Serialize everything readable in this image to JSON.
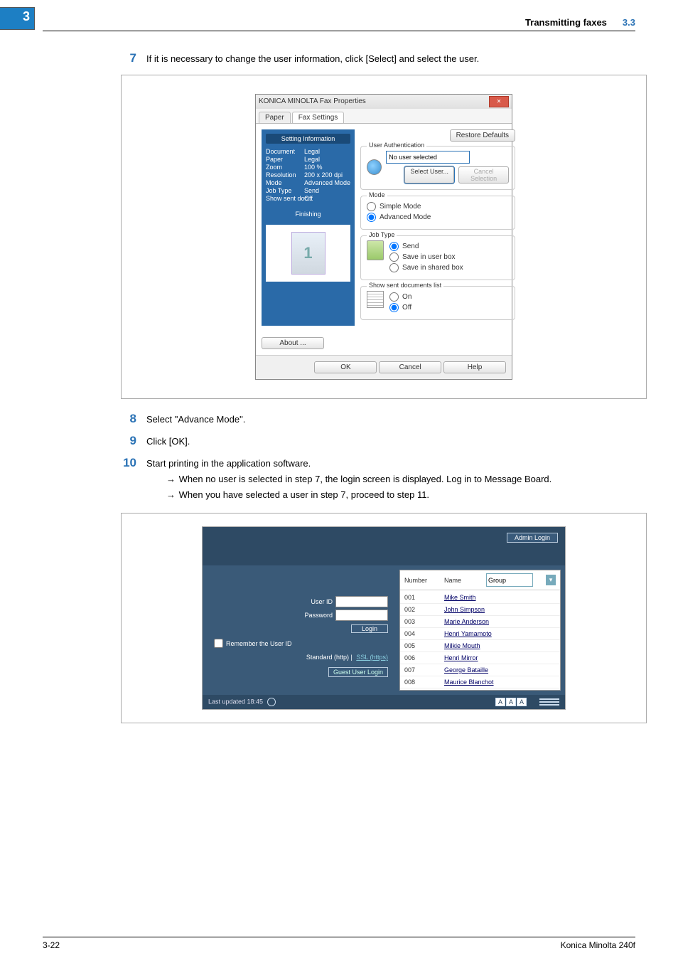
{
  "chapter_num": "3",
  "header": {
    "title": "Transmitting faxes",
    "section": "3.3"
  },
  "steps": {
    "7": {
      "num": "7",
      "text": "If it is necessary to change the user information, click [Select] and select the user."
    },
    "8": {
      "num": "8",
      "text": "Select \"Advance Mode\"."
    },
    "9": {
      "num": "9",
      "text": "Click [OK]."
    },
    "10": {
      "num": "10",
      "text": "Start printing in the application software.",
      "subs": {
        "a": "When no user is selected in step 7, the login screen is displayed. Log in to Message Board.",
        "b": "When you have selected a user in step 7, proceed to step 11."
      }
    }
  },
  "fax_dialog": {
    "title": "KONICA MINOLTA Fax Properties",
    "tabs": {
      "paper": "Paper",
      "fax": "Fax Settings"
    },
    "info": {
      "heading": "Setting Information",
      "rows": {
        "doc_k": "Document",
        "doc_v": "Legal",
        "paper_k": "Paper",
        "paper_v": "Legal",
        "zoom_k": "Zoom",
        "zoom_v": "100 %",
        "res_k": "Resolution",
        "res_v": "200 x 200 dpi",
        "mode_k": "Mode",
        "mode_v": "Advanced Mode",
        "job_k": "Job Type",
        "job_v": "Send",
        "show_k": "Show sent doc...",
        "show_v": "Off"
      },
      "finishing": "Finishing",
      "doc_num": "1"
    },
    "restore": "Restore Defaults",
    "auth": {
      "legend": "User Authentication",
      "no_user": "No user selected",
      "select": "Select User...",
      "cancel": "Cancel Selection"
    },
    "mode": {
      "legend": "Mode",
      "simple": "Simple Mode",
      "advanced": "Advanced Mode"
    },
    "job": {
      "legend": "Job Type",
      "send": "Send",
      "userbox": "Save in user box",
      "shared": "Save in shared box"
    },
    "showlist": {
      "legend": "Show sent documents list",
      "on": "On",
      "off": "Off"
    },
    "about": "About ...",
    "footer": {
      "ok": "OK",
      "cancel": "Cancel",
      "help": "Help"
    }
  },
  "login": {
    "admin": "Admin Login",
    "user_id": "User ID",
    "password": "Password",
    "login": "Login",
    "remember": "Remember the User ID",
    "std": "Standard (http)",
    "ssl": "SSL (https)",
    "guest": "Guest User Login",
    "cols": {
      "number": "Number",
      "name": "Name",
      "group": "Group"
    },
    "rows": [
      {
        "num": "001",
        "name": "Mike Smith"
      },
      {
        "num": "002",
        "name": "John Simpson"
      },
      {
        "num": "003",
        "name": "Marie Anderson"
      },
      {
        "num": "004",
        "name": "Henri Yamamoto"
      },
      {
        "num": "005",
        "name": "Milkie Mouth"
      },
      {
        "num": "006",
        "name": "Henri Mirror"
      },
      {
        "num": "007",
        "name": "George Bataille"
      },
      {
        "num": "008",
        "name": "Maurice Blanchot"
      }
    ],
    "updated": "Last updated 18:45"
  },
  "footer": {
    "page": "3-22",
    "brand": "Konica Minolta 240f"
  }
}
